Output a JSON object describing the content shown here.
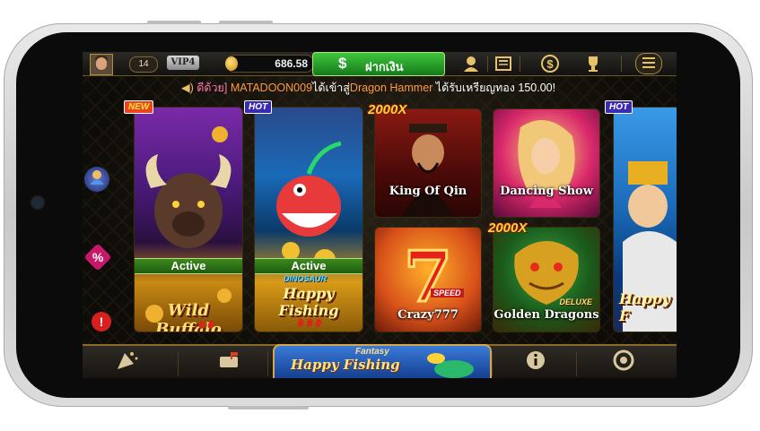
{
  "header": {
    "level": "14",
    "vip": "VIP4",
    "balance": "686.58",
    "deposit_label": "ฝากเงิน",
    "deposit_symbol": "$",
    "icons": [
      "support-icon",
      "news-icon",
      "dollar-icon",
      "trophy-icon",
      "menu-icon"
    ]
  },
  "ticker": {
    "prefix": "ดีด้วย]",
    "player": "MATADOON009",
    "joined": "ได้เข้าสู่",
    "game": "Dragon Hammer",
    "received": "ได้รับเหรียญทอง",
    "amount": "150.00!"
  },
  "side": {
    "promo_symbol": "%",
    "alert_symbol": "!"
  },
  "games": [
    {
      "name": "Wild Buffalo",
      "tag": "NEW",
      "status": "Active"
    },
    {
      "name": "Happy Fishing",
      "sub": "DINOSAUR",
      "tag": "HOT",
      "status": "Active"
    },
    {
      "name": "King Of Qin",
      "mult": "2000X"
    },
    {
      "name": "Dancing Show"
    },
    {
      "name": "Crazy777",
      "sub": "SPEED"
    },
    {
      "name": "Golden Dragons",
      "sub": "DELUXE",
      "mult": "2000X"
    },
    {
      "name": "Happy F",
      "tag": "HOT"
    }
  ],
  "bottom": {
    "banner_small": "Fantasy",
    "banner_main": "Happy Fishing"
  },
  "colors": {
    "gold": "#e6c36a",
    "deposit_green": "#2aa52a",
    "active_green": "#3b8a1e",
    "hot_tag": "#3b2bb0",
    "new_tag": "#e8461a"
  }
}
